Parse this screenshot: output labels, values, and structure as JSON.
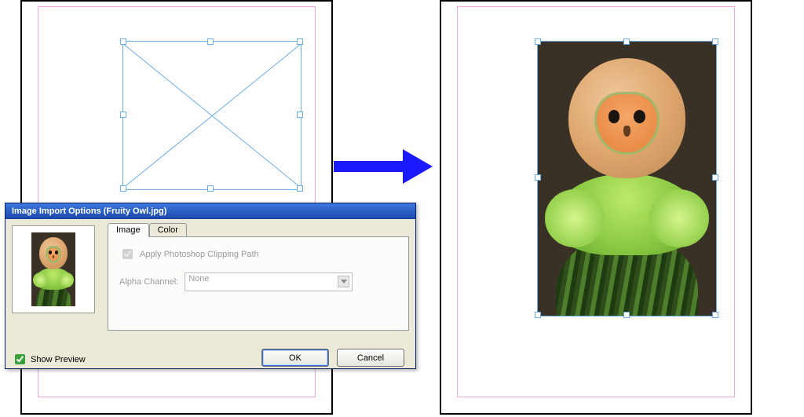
{
  "dialog": {
    "title": "Image Import Options (Fruity Owl.jpg)",
    "tabs": {
      "image": "Image",
      "color": "Color"
    },
    "apply_clipping_label": "Apply Photoshop Clipping Path",
    "alpha_label": "Alpha Channel:",
    "alpha_value": "None",
    "show_preview_label": "Show Preview",
    "ok": "OK",
    "cancel": "Cancel"
  },
  "left_page": {
    "frame_has_image": false
  },
  "right_page": {
    "frame_has_image": true
  }
}
